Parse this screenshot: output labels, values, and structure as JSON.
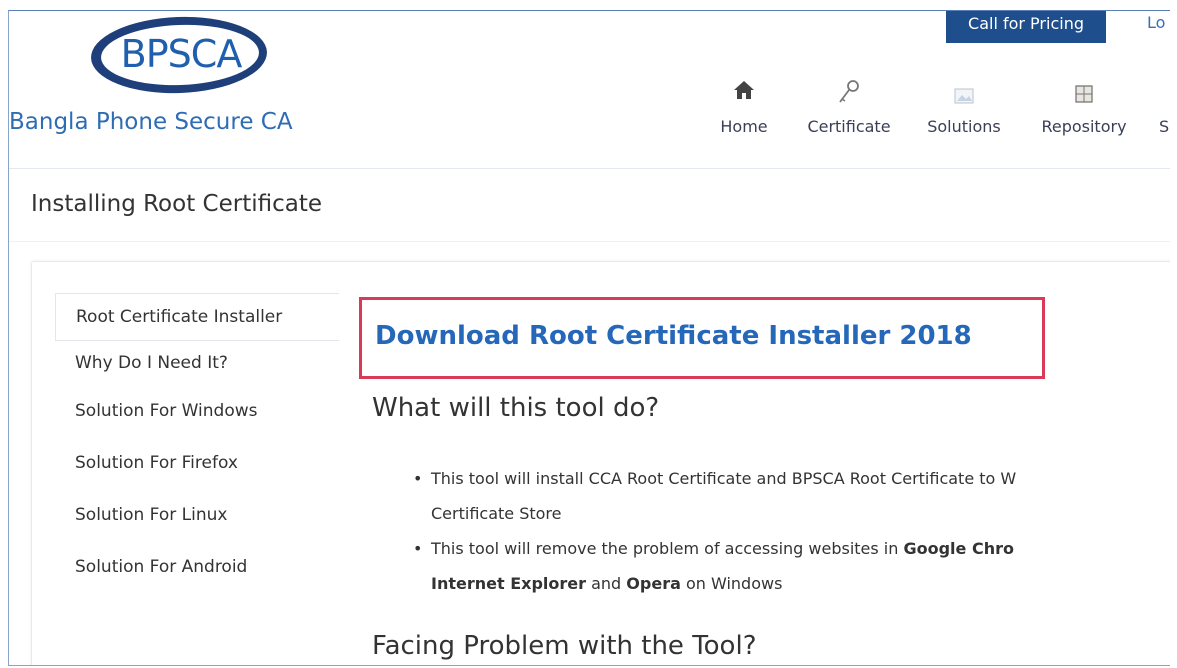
{
  "header": {
    "logo_text_pre": "BPS",
    "logo_text_post": "CA",
    "brand_name": "Bangla Phone Secure CA",
    "call_button": "Call for Pricing",
    "login_partial": "Lo"
  },
  "nav": [
    {
      "label": "Home",
      "icon": "home-icon"
    },
    {
      "label": "Certificate",
      "icon": "key-icon"
    },
    {
      "label": "Solutions",
      "icon": "image-icon"
    },
    {
      "label": "Repository",
      "icon": "cabinet-icon"
    },
    {
      "label": "S",
      "icon": ""
    }
  ],
  "page": {
    "title": "Installing Root Certificate"
  },
  "sidebar": {
    "items": [
      {
        "label": "Root Certificate Installer"
      },
      {
        "label": "Why Do I Need It?"
      },
      {
        "label": "Solution For Windows"
      },
      {
        "label": "Solution For Firefox"
      },
      {
        "label": "Solution For Linux"
      },
      {
        "label": "Solution For Android"
      }
    ]
  },
  "content": {
    "download_link": "Download Root Certificate Installer 2018",
    "heading1": "What will this tool do?",
    "bullet1_line1": "This tool will install CCA Root Certificate and BPSCA Root Certificate to W",
    "bullet1_line2": "Certificate Store",
    "bullet2_pre": "This tool will remove the problem of accessing websites in ",
    "bullet2_bold1": "Google Chro",
    "bullet2_bold2": "Internet Explorer",
    "bullet2_mid": " and ",
    "bullet2_bold3": "Opera",
    "bullet2_post": " on Windows",
    "heading2": "Facing Problem with the Tool?"
  },
  "colors": {
    "brand_blue": "#2e6db4",
    "nav_button": "#1f4e8c",
    "highlight_border": "#d83a57",
    "link_blue": "#2567b8"
  }
}
